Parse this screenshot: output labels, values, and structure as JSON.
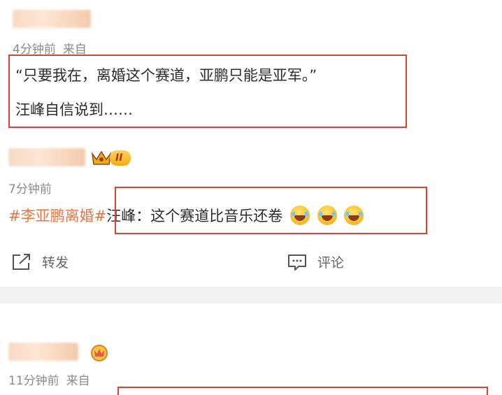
{
  "comments": [
    {
      "time": "4分钟前",
      "source_label": "来自",
      "lines": [
        "“只要我在，离婚这个赛道，亚鹏只能是亚军。”",
        "汪峰自信说到……"
      ]
    },
    {
      "time": "7分钟前",
      "level_badge": "II",
      "hashtag": "#李亚鹏离婚#",
      "text": "汪峰：这个赛道比音乐还卷"
    },
    {
      "time": "11分钟前",
      "source_label": "来自"
    }
  ],
  "actions": {
    "repost_label": "转发",
    "comment_label": "评论"
  },
  "colors": {
    "highlight_box": "#d8442f",
    "hashtag": "#eb7340",
    "meta_text": "#8a8a8a"
  },
  "icons": [
    "share-icon",
    "comment-icon",
    "crown-icon",
    "emblem-icon",
    "laugh-cry-emoji-icon"
  ]
}
